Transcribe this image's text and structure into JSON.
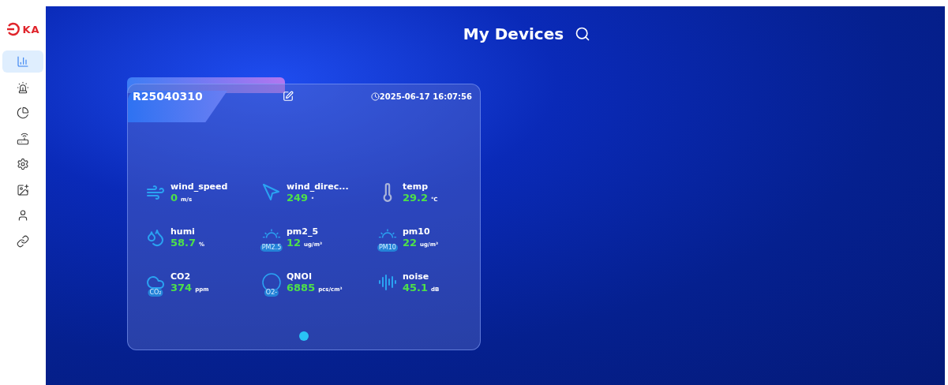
{
  "logo": {
    "text": "KA"
  },
  "sidebar": {
    "items": [
      {
        "kind": "chart",
        "selected": true
      },
      {
        "kind": "alarm",
        "selected": false
      },
      {
        "kind": "pie",
        "selected": false
      },
      {
        "kind": "device",
        "selected": false
      },
      {
        "kind": "settings",
        "selected": false
      },
      {
        "kind": "image",
        "selected": false
      },
      {
        "kind": "user",
        "selected": false
      },
      {
        "kind": "link",
        "selected": false
      }
    ]
  },
  "header": {
    "title": "My Devices"
  },
  "device": {
    "name": "R25040310",
    "time": "2025-06-17 16:07:56",
    "metrics": [
      {
        "kind": "wind",
        "name": "wind_speed",
        "value": "0",
        "unit": "m/s"
      },
      {
        "kind": "direction",
        "name": "wind_direc...",
        "value": "249",
        "unit": "°"
      },
      {
        "kind": "temp",
        "name": "temp",
        "value": "29.2",
        "unit": "℃"
      },
      {
        "kind": "humidity",
        "name": "humi",
        "value": "58.7",
        "unit": "%"
      },
      {
        "kind": "dust",
        "name": "pm2_5",
        "value": "12",
        "unit": "ug/m³",
        "badge": "PM2.5"
      },
      {
        "kind": "dust",
        "name": "pm10",
        "value": "22",
        "unit": "ug/m³",
        "badge": "PM10"
      },
      {
        "kind": "cloud",
        "name": "CO2",
        "value": "374",
        "unit": "ppm",
        "badge": "CO₂"
      },
      {
        "kind": "ion",
        "name": "QNOI",
        "value": "6885",
        "unit": "pcs/cm³",
        "badge": "O2-"
      },
      {
        "kind": "noise",
        "name": "noise",
        "value": "45.1",
        "unit": "dB"
      }
    ],
    "pages": [
      {
        "selected": true
      }
    ]
  }
}
